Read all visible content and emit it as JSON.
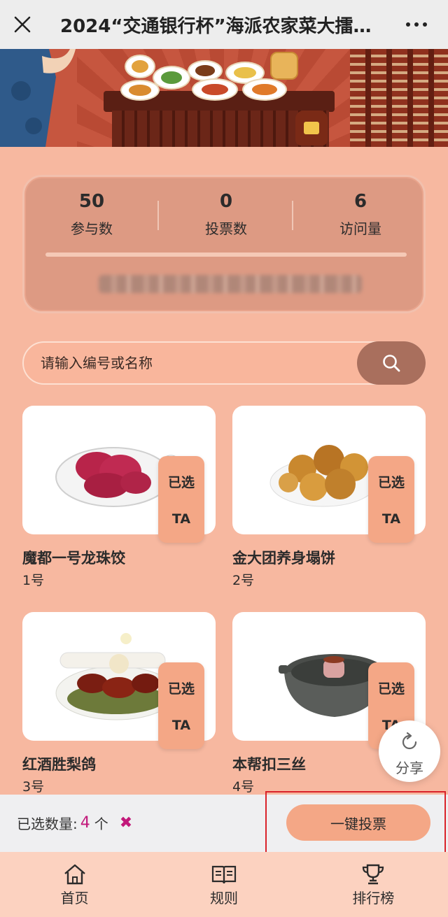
{
  "navbar": {
    "title": "2024“交通银行杯”海派农家菜大擂…",
    "close_icon": "close-icon",
    "more_icon": "more-icon"
  },
  "stats": {
    "items": [
      {
        "value": "50",
        "label": "参与数"
      },
      {
        "value": "0",
        "label": "投票数"
      },
      {
        "value": "6",
        "label": "访问量"
      }
    ]
  },
  "search": {
    "placeholder": "请输入编号或名称",
    "value": "",
    "icon": "search-icon"
  },
  "cards": [
    {
      "name": "魔都一号龙珠饺",
      "number": "1号",
      "badge_top": "已选",
      "badge_bottom": "TA"
    },
    {
      "name": "金大团养身塌饼",
      "number": "2号",
      "badge_top": "已选",
      "badge_bottom": "TA"
    },
    {
      "name": "红酒胜梨鸽",
      "number": "3号",
      "badge_top": "已选",
      "badge_bottom": "TA"
    },
    {
      "name": "本帮扣三丝",
      "number": "4号",
      "badge_top": "已选",
      "badge_bottom": "TA"
    }
  ],
  "share": {
    "label": "分享",
    "icon": "refresh-share-icon"
  },
  "action_bar": {
    "selected_label": "已选数量:",
    "selected_count": "4",
    "selected_unit": "个",
    "clear_symbol": "✖",
    "vote_button": "一键投票"
  },
  "tabbar": {
    "items": [
      {
        "label": "首页",
        "icon": "home-icon"
      },
      {
        "label": "规则",
        "icon": "book-icon"
      },
      {
        "label": "排行榜",
        "icon": "trophy-icon"
      }
    ]
  },
  "colors": {
    "page_bg": "#f7b8a0",
    "accent": "#f4a786",
    "count_highlight": "#c2187a",
    "annotation_border": "#d9232a"
  }
}
